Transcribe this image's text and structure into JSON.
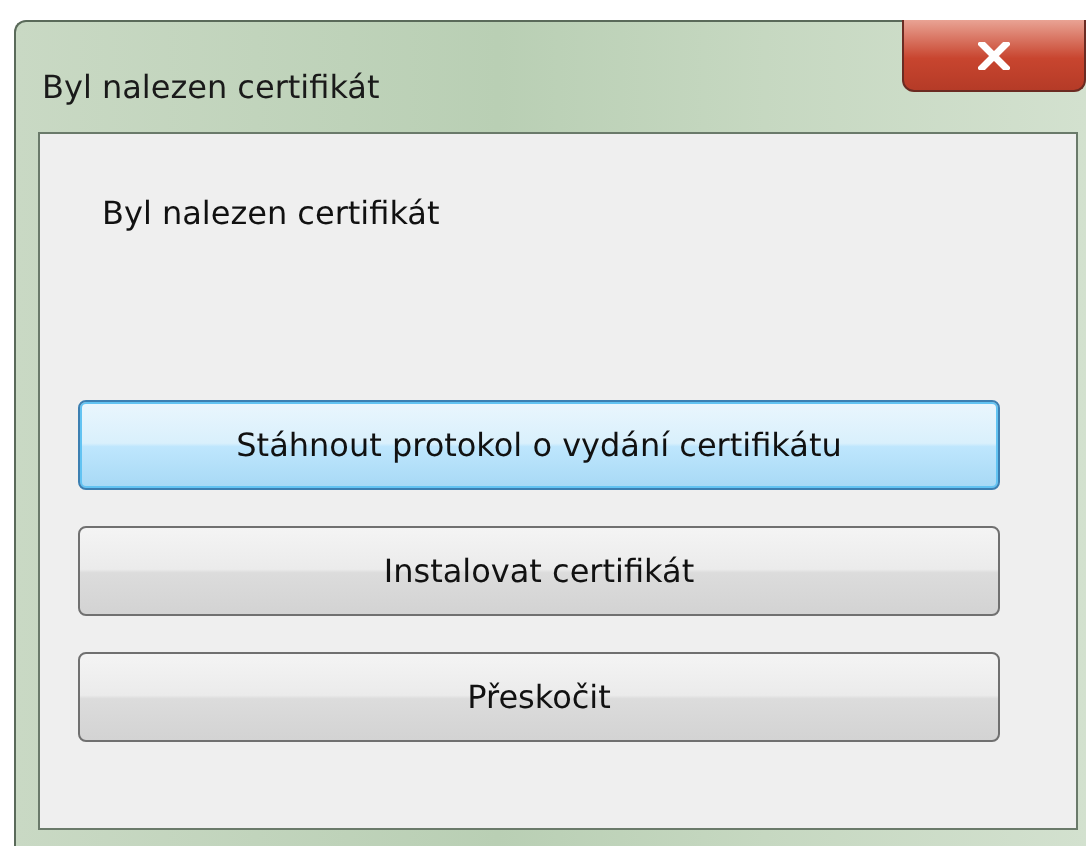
{
  "window": {
    "title": "Byl nalezen certifikát"
  },
  "message": "Byl nalezen certifikát",
  "buttons": [
    {
      "label": "Stáhnout protokol o vydání certifikátu",
      "focused": true
    },
    {
      "label": "Instalovat certifikát",
      "focused": false
    },
    {
      "label": "Přeskočit",
      "focused": false
    }
  ]
}
